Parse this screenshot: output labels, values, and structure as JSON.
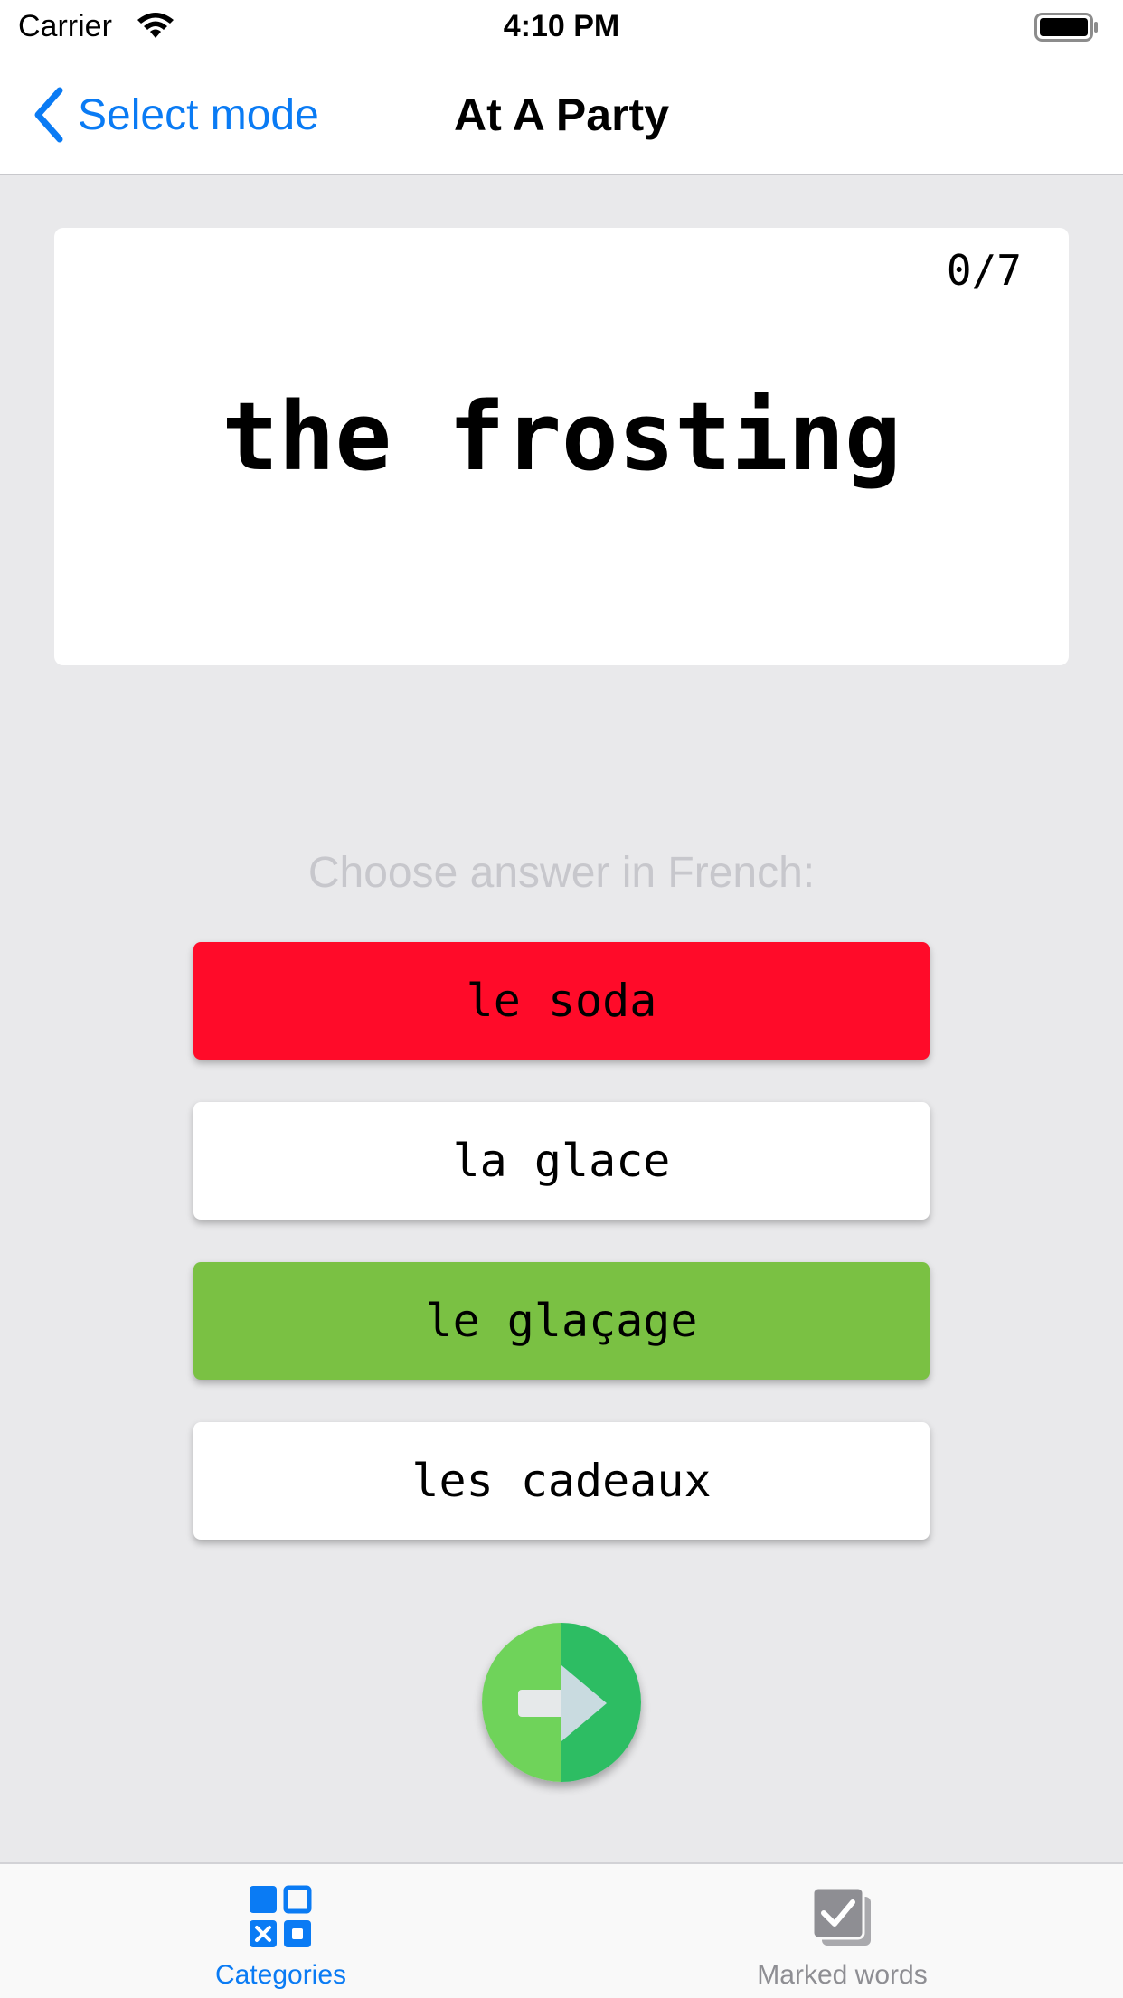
{
  "status_bar": {
    "carrier": "Carrier",
    "time": "4:10 PM"
  },
  "nav": {
    "back_label": "Select mode",
    "title": "At A Party"
  },
  "card": {
    "progress": "0/7",
    "word": "the frosting"
  },
  "prompt": "Choose answer in French:",
  "answers": [
    {
      "label": "le soda",
      "state": "wrong",
      "color": "#ff0b29"
    },
    {
      "label": "la glace",
      "state": "default",
      "color": "#ffffff"
    },
    {
      "label": "le glaçage",
      "state": "correct",
      "color": "#7ac143"
    },
    {
      "label": "les cadeaux",
      "state": "default",
      "color": "#ffffff"
    }
  ],
  "next_button": {
    "icon": "arrow-right-icon"
  },
  "tabs": [
    {
      "label": "Categories",
      "icon": "categories-grid-icon",
      "active": true
    },
    {
      "label": "Marked words",
      "icon": "checkbox-stack-icon",
      "active": false
    }
  ],
  "colors": {
    "accent": "#0a7bf4",
    "inactive_tab": "#8e8e93",
    "background": "#e9e9eb"
  }
}
